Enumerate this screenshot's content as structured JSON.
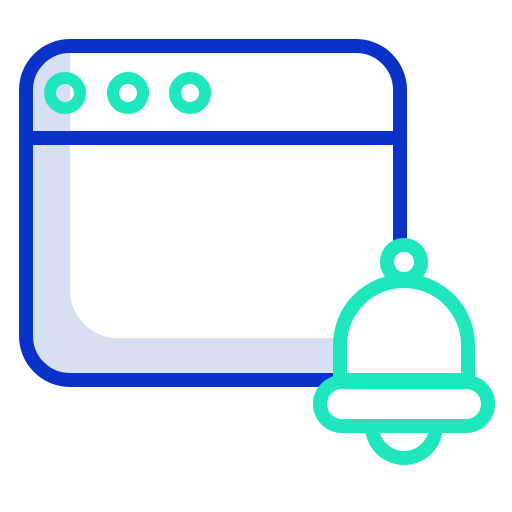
{
  "icon": {
    "name": "browser-window-notification-bell-icon",
    "colors": {
      "window_stroke": "#0a32c9",
      "window_fill": "#d7e0f2",
      "accent": "#1ee6bd",
      "background": "#ffffff"
    },
    "parts": [
      "browser-window-icon",
      "window-control-dots",
      "notification-bell-icon"
    ]
  }
}
